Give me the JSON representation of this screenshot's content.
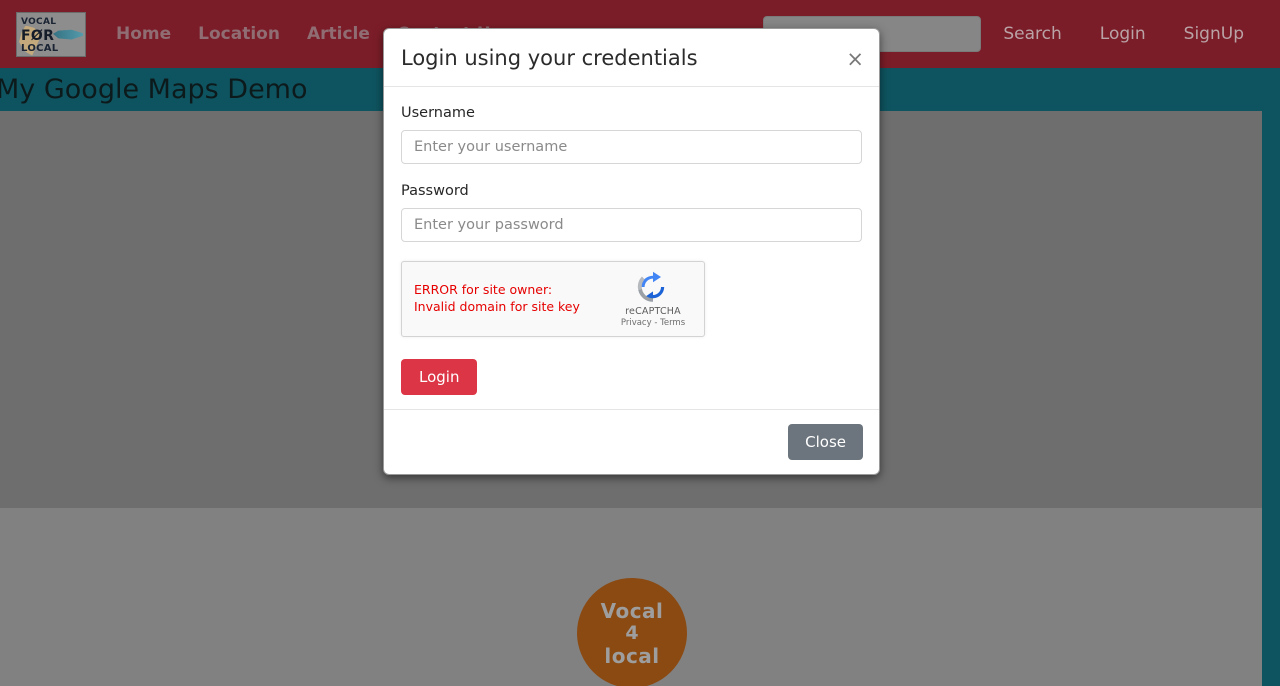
{
  "navbar": {
    "logo": {
      "line1": "VOCAL",
      "line2": "FØR",
      "line3": "LOCAL",
      "alt": "vocal-for-local-logo"
    },
    "links": [
      {
        "label": "Home"
      },
      {
        "label": "Location"
      },
      {
        "label": "Article"
      },
      {
        "label": "Contact Us"
      }
    ],
    "search": {
      "value": "",
      "placeholder": ""
    },
    "actions": [
      {
        "label": "Search"
      },
      {
        "label": "Login"
      },
      {
        "label": "SignUp"
      }
    ]
  },
  "page": {
    "title": "My Google Maps Demo",
    "footer_logo": {
      "line1": "Vocal",
      "line2": "4",
      "line3": "local"
    }
  },
  "modal": {
    "title": "Login using your credentials",
    "close_icon": "×",
    "fields": [
      {
        "label": "Username",
        "placeholder": "Enter your username",
        "value": "",
        "type": "text"
      },
      {
        "label": "Password",
        "placeholder": "Enter your password",
        "value": "",
        "type": "password"
      }
    ],
    "recaptcha": {
      "error_line1": "ERROR for site owner:",
      "error_line2": "Invalid domain for site key",
      "brand": "reCAPTCHA",
      "links": "Privacy - Terms"
    },
    "login_label": "Login",
    "close_label": "Close"
  },
  "colors": {
    "navbar": "#7b1d28",
    "banner": "#0e5460",
    "map": "#6e6e6e",
    "lower": "#818181",
    "login_button": "#dc3545",
    "close_button": "#6c757d",
    "error": "#e60000",
    "footer_logo": "#8b4a12"
  }
}
